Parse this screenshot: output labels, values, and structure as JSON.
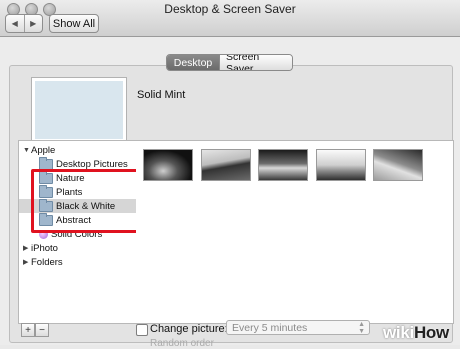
{
  "window": {
    "title": "Desktop & Screen Saver",
    "show_all_label": "Show All"
  },
  "tabs": [
    {
      "label": "Desktop",
      "selected": true
    },
    {
      "label": "Screen Saver",
      "selected": false
    }
  ],
  "preview": {
    "name": "Solid Mint",
    "color": "#d9e6ee"
  },
  "sidebar": {
    "apple_group": "Apple",
    "items": [
      {
        "label": "Desktop Pictures",
        "icon": "folder-icon"
      },
      {
        "label": "Nature",
        "icon": "folder-icon"
      },
      {
        "label": "Plants",
        "icon": "folder-icon"
      },
      {
        "label": "Black & White",
        "icon": "folder-icon",
        "selected": true
      },
      {
        "label": "Abstract",
        "icon": "folder-icon"
      },
      {
        "label": "Solid Colors",
        "icon": "color-dot-icon"
      }
    ],
    "iphoto_group": "iPhoto",
    "folders_group": "Folders"
  },
  "footer": {
    "add_label": "+",
    "remove_label": "−",
    "change_picture_label": "Change picture:",
    "change_picture_checked": false,
    "interval_value": "Every 5 minutes",
    "random_order_label": "Random order"
  },
  "watermark": {
    "part1": "wiki",
    "part2": "How"
  },
  "colors": {
    "highlight": "#e0121f",
    "selected_row": "#d6d6d6"
  }
}
